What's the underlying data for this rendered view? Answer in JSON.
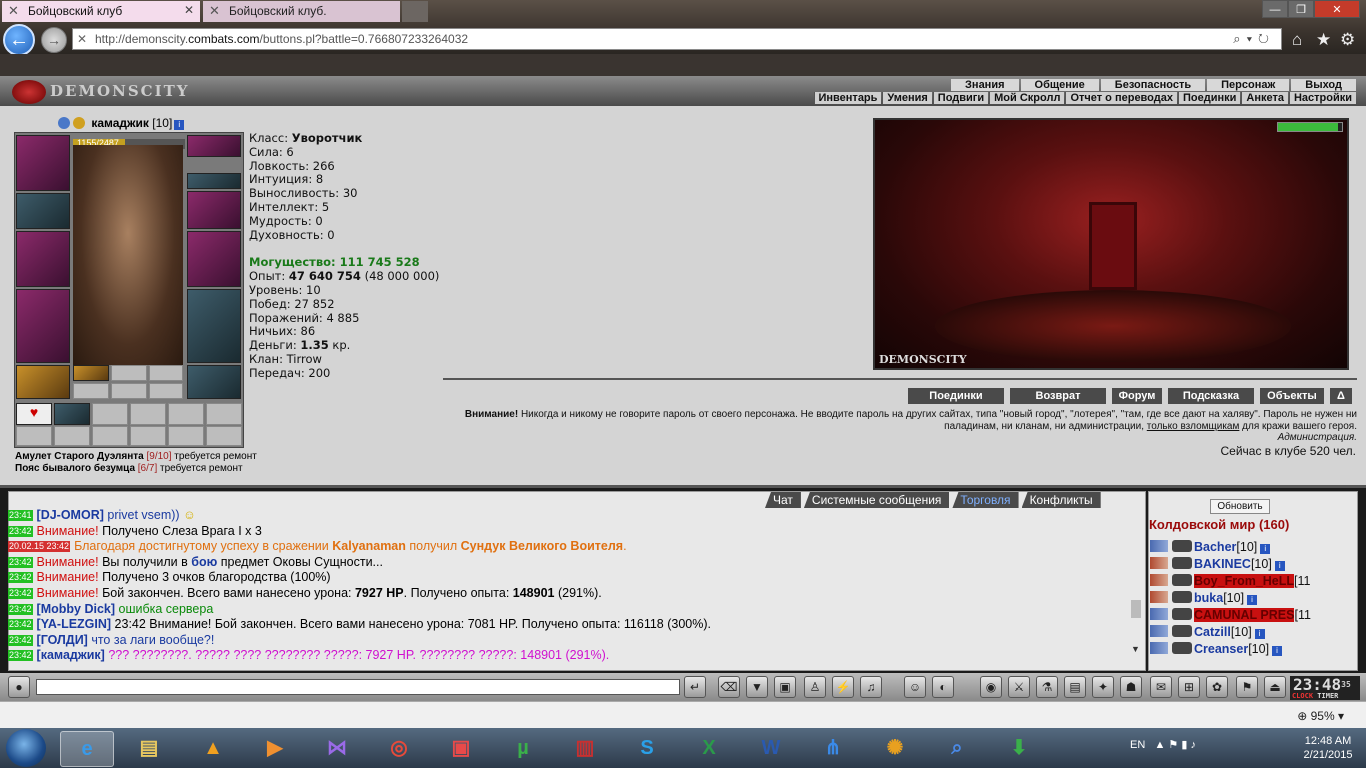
{
  "browser": {
    "url_prefix": "http://demonscity.",
    "url_domain": "combats.com",
    "url_path": "/buttons.pl?battle=0.766807233264032",
    "tabs": [
      {
        "label": "Бойцовский клуб"
      },
      {
        "label": "Бойцовский клуб."
      }
    ],
    "zoom": "95%"
  },
  "game": {
    "logo": "DEMONSCITY",
    "menu_top": [
      "Знания",
      "Общение",
      "Безопасность",
      "Персонаж",
      "Выход"
    ],
    "menu_sub": [
      "Инвентарь",
      "Умения",
      "Подвиги",
      "Мой Скролл",
      "Отчет о переводах",
      "Поединки",
      "Анкета",
      "Настройки"
    ]
  },
  "character": {
    "name": "камаджик",
    "level": "[10]",
    "hp": "1155/2487",
    "hp_fraction": 0.464,
    "class_label": "Класс:",
    "class_value": "Уворотчик",
    "stats": [
      "Сила: 6",
      "Ловкость: 266",
      "Интуиция: 8",
      "Выносливость: 30",
      "Интеллект: 5",
      "Мудрость: 0",
      "Духовность: 0"
    ],
    "might": "Могущество: 111 745 528",
    "exp_label": "Опыт: ",
    "exp_value": "47 640 754",
    "exp_next": " (48 000 000)",
    "info": [
      "Уровень: 10",
      "Побед: 27 852",
      "Поражений: 4 885",
      "Ничьих: 86"
    ],
    "money_label": "Деньги: ",
    "money_value": "1.35",
    "money_unit": " кр.",
    "clan": "Клан: Tirrow",
    "transfers": "Передач: 200",
    "repair": [
      {
        "item": "Амулет Старого Дуэлянта",
        "dur": "[9/10]",
        "note": " требуется ремонт"
      },
      {
        "item": "Пояс бывалого безумца",
        "dur": "[6/7]",
        "note": " требуется ремонт"
      }
    ]
  },
  "scene": {
    "label": "DEMONSCITY"
  },
  "actions": [
    "Поединки",
    "Возврат",
    "Форум",
    "Подсказка",
    "Объекты",
    "Δ"
  ],
  "warning": {
    "bold": "Внимание!",
    "text": " Никогда и никому не говорите пароль от своего персонажа. Не вводите пароль на других сайтах, типа \"новый город\", \"лотерея\", \"там, где все дают на халяву\". Пароль не нужен ни паладинам, ни кланам, ни администрации, ",
    "link": "только взломщикам",
    "tail": " для кражи вашего героя.",
    "signature": "Администрация."
  },
  "online": "Сейчас в клубе 520 чел.",
  "chat": {
    "tabs": [
      "Чат",
      "Системные сообщения",
      "Торговля",
      "Конфликты"
    ]
  },
  "chat_lines": [
    {
      "t": "23:41",
      "nick": "[DJ-OMOR]",
      "msg": " privet vsem))"
    },
    {
      "t": "23:42",
      "warn": "Внимание!",
      "msg": " Получено Слеза Врага I x 3"
    },
    {
      "t": "20.02.15 23:42",
      "msg1": "Благодаря достигнутому успеху в сражении ",
      "who": "Kalyanaman",
      "msg2": " получил ",
      "item": "Сундук Великого Воителя",
      "end": "."
    },
    {
      "t": "23:42",
      "warn": "Внимание!",
      "msg": " Вы получили в ",
      "link": "бою",
      "msg2": " предмет Оковы Сущности..."
    },
    {
      "t": "23:42",
      "warn": "Внимание!",
      "msg": " Получено 3 очков благородства (100%)"
    },
    {
      "t": "23:42",
      "warn": "Внимание!",
      "msg": " Бой закончен. Всего вами нанесено урона: ",
      "b1": "7927 HP",
      "msg2": ". Получено опыта: ",
      "b2": "148901",
      "end": " (291%)."
    },
    {
      "t": "23:42",
      "nick": "[Mobby Dick]",
      "msg": " ошибка сервера"
    },
    {
      "t": "23:42",
      "nick": "[YA-LEZGIN]",
      "msg": " 23:42 Внимание! Бой закончен. Всего вами нанесено урона: 7081 HP. Получено опыта: 116118 (300%)."
    },
    {
      "t": "23:42",
      "nick": "[ГОЛДИ]",
      "msg": " что за лаги вообще?!"
    },
    {
      "t": "23:42",
      "nick": "[камаджик]",
      "msg": " ??? ????????. ????? ???? ???????? ?????: 7927 HP. ???????? ?????: 148901 (291%)."
    }
  ],
  "users": {
    "refresh": "Обновить",
    "world": "Колдовской мир (160)",
    "list": [
      {
        "name": "Bacher",
        "lvl": "[10]"
      },
      {
        "name": "BAKINEC",
        "lvl": "[10]"
      },
      {
        "name": "Boy_From_HeLL",
        "lvl": "[11"
      },
      {
        "name": "buka",
        "lvl": "[10]"
      },
      {
        "name": "CAMUNAL PRES",
        "lvl": "[11"
      },
      {
        "name": "Catzill",
        "lvl": "[10]"
      },
      {
        "name": "Creanser",
        "lvl": "[10]"
      }
    ]
  },
  "game_clock": {
    "time": "23:48",
    "sec": "35",
    "label_a": "CLOCK",
    "label_b": "TIMER"
  },
  "taskbar": {
    "lang": "EN",
    "time": "12:48 AM",
    "date": "2/21/2015"
  }
}
